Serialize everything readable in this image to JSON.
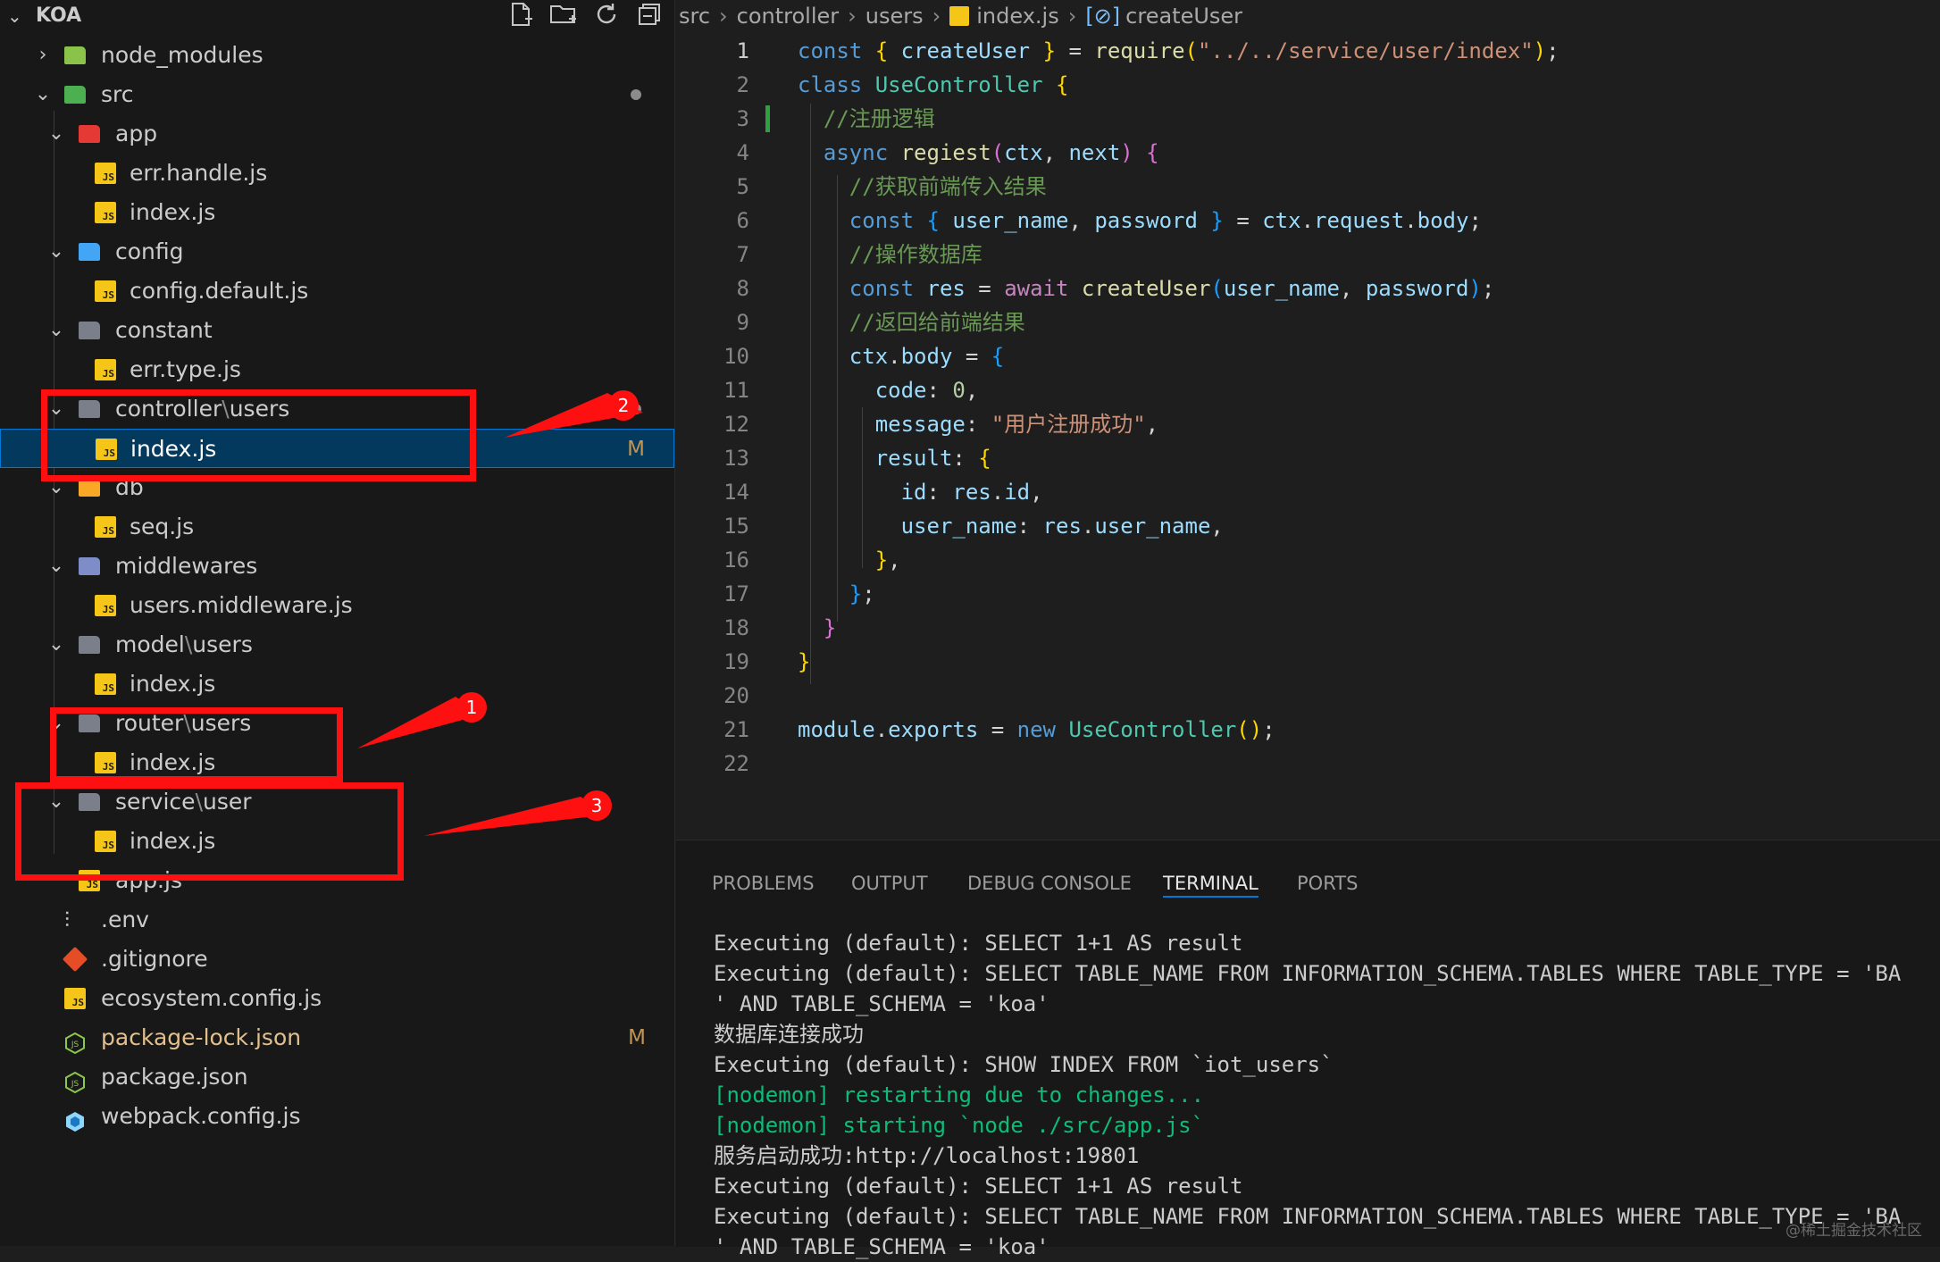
{
  "explorer": {
    "title": "KOA",
    "toolbar_icons": [
      "new-file-icon",
      "new-folder-icon",
      "refresh-icon",
      "collapse-all-icon"
    ],
    "tree": [
      {
        "label": "node_modules",
        "depth": 1,
        "kind": "folder",
        "expanded": false
      },
      {
        "label": "src",
        "depth": 1,
        "kind": "folder",
        "expanded": true
      },
      {
        "label": "app",
        "depth": 2,
        "kind": "folder",
        "expanded": true
      },
      {
        "label": "err.handle.js",
        "depth": 3,
        "kind": "js"
      },
      {
        "label": "index.js",
        "depth": 3,
        "kind": "js"
      },
      {
        "label": "config",
        "depth": 2,
        "kind": "folder",
        "expanded": true
      },
      {
        "label": "config.default.js",
        "depth": 3,
        "kind": "js"
      },
      {
        "label": "constant",
        "depth": 2,
        "kind": "folder",
        "expanded": true
      },
      {
        "label": "err.type.js",
        "depth": 3,
        "kind": "js"
      },
      {
        "label_a": "controller",
        "label_b": "users",
        "depth": 2,
        "kind": "folder",
        "expanded": true
      },
      {
        "label": "index.js",
        "depth": 3,
        "kind": "js",
        "selected": true,
        "badge": "M"
      },
      {
        "label": "db",
        "depth": 2,
        "kind": "folder",
        "expanded": true
      },
      {
        "label": "seq.js",
        "depth": 3,
        "kind": "js"
      },
      {
        "label": "middlewares",
        "depth": 2,
        "kind": "folder",
        "expanded": true
      },
      {
        "label": "users.middleware.js",
        "depth": 3,
        "kind": "js"
      },
      {
        "label_a": "model",
        "label_b": "users",
        "depth": 2,
        "kind": "folder",
        "expanded": true
      },
      {
        "label": "index.js",
        "depth": 3,
        "kind": "js"
      },
      {
        "label_a": "router",
        "label_b": "users",
        "depth": 2,
        "kind": "folder",
        "expanded": true
      },
      {
        "label": "index.js",
        "depth": 3,
        "kind": "js"
      },
      {
        "label_a": "service",
        "label_b": "user",
        "depth": 2,
        "kind": "folder",
        "expanded": true
      },
      {
        "label": "index.js",
        "depth": 3,
        "kind": "js"
      },
      {
        "label": "app.js",
        "depth": 2,
        "kind": "js"
      },
      {
        "label": ".env",
        "depth": 1,
        "kind": "env"
      },
      {
        "label": ".gitignore",
        "depth": 1,
        "kind": "git"
      },
      {
        "label": "ecosystem.config.js",
        "depth": 1,
        "kind": "js"
      },
      {
        "label": "package-lock.json",
        "depth": 1,
        "kind": "npm",
        "badge": "M"
      },
      {
        "label": "package.json",
        "depth": 1,
        "kind": "npm"
      },
      {
        "label": "webpack.config.js",
        "depth": 1,
        "kind": "webpack"
      }
    ],
    "annotations": [
      "1",
      "2",
      "3"
    ],
    "colors": {
      "highlight_red": "#ff1010",
      "selection": "#04395e",
      "modified": "#c09553"
    }
  },
  "breadcrumb": [
    "src",
    "controller",
    "users",
    "index.js",
    "createUser"
  ],
  "editor": {
    "active_line": 1,
    "line_numbers": [
      "1",
      "2",
      "3",
      "4",
      "5",
      "6",
      "7",
      "8",
      "9",
      "10",
      "11",
      "12",
      "13",
      "14",
      "15",
      "16",
      "17",
      "18",
      "19",
      "20",
      "21",
      "22"
    ],
    "lines": [
      [
        [
          "k",
          "const "
        ],
        [
          "p1",
          "{ "
        ],
        [
          "v",
          "createUser "
        ],
        [
          "p1",
          "} "
        ],
        [
          "op",
          "= "
        ],
        [
          "fn",
          "require"
        ],
        [
          "p1",
          "("
        ],
        [
          "s",
          "\"../../service/user/index\""
        ],
        [
          "p1",
          ")"
        ],
        [
          "op",
          ";"
        ]
      ],
      [
        [
          "k",
          "class "
        ],
        [
          "cls",
          "UseController "
        ],
        [
          "p1",
          "{"
        ]
      ],
      [
        [
          "c",
          "  //注册逻辑"
        ]
      ],
      [
        [
          "k",
          "  async "
        ],
        [
          "fn",
          "regiest"
        ],
        [
          "p2",
          "("
        ],
        [
          "v",
          "ctx"
        ],
        [
          "op",
          ", "
        ],
        [
          "v",
          "next"
        ],
        [
          "p2",
          ") {"
        ]
      ],
      [
        [
          "c",
          "    //获取前端传入结果"
        ]
      ],
      [
        [
          "k",
          "    const "
        ],
        [
          "p3",
          "{ "
        ],
        [
          "v",
          "user_name"
        ],
        [
          "op",
          ", "
        ],
        [
          "v",
          "password "
        ],
        [
          "p3",
          "} "
        ],
        [
          "op",
          "= "
        ],
        [
          "v",
          "ctx"
        ],
        [
          "op",
          "."
        ],
        [
          "v",
          "request"
        ],
        [
          "op",
          "."
        ],
        [
          "v",
          "body"
        ],
        [
          "op",
          ";"
        ]
      ],
      [
        [
          "c",
          "    //操作数据库"
        ]
      ],
      [
        [
          "k",
          "    const "
        ],
        [
          "v",
          "res "
        ],
        [
          "op",
          "= "
        ],
        [
          "ctl",
          "await "
        ],
        [
          "fn",
          "createUser"
        ],
        [
          "p3",
          "("
        ],
        [
          "v",
          "user_name"
        ],
        [
          "op",
          ", "
        ],
        [
          "v",
          "password"
        ],
        [
          "p3",
          ")"
        ],
        [
          "op",
          ";"
        ]
      ],
      [
        [
          "c",
          "    //返回给前端结果"
        ]
      ],
      [
        [
          "v",
          "    ctx"
        ],
        [
          "op",
          "."
        ],
        [
          "v",
          "body "
        ],
        [
          "op",
          "= "
        ],
        [
          "p3",
          "{"
        ]
      ],
      [
        [
          "v",
          "      code"
        ],
        [
          "op",
          ": "
        ],
        [
          "n",
          "0"
        ],
        [
          "op",
          ","
        ]
      ],
      [
        [
          "v",
          "      message"
        ],
        [
          "op",
          ": "
        ],
        [
          "s",
          "\"用户注册成功\""
        ],
        [
          "op",
          ","
        ]
      ],
      [
        [
          "v",
          "      result"
        ],
        [
          "op",
          ": "
        ],
        [
          "p1",
          "{"
        ]
      ],
      [
        [
          "v",
          "        id"
        ],
        [
          "op",
          ": "
        ],
        [
          "v",
          "res"
        ],
        [
          "op",
          "."
        ],
        [
          "v",
          "id"
        ],
        [
          "op",
          ","
        ]
      ],
      [
        [
          "v",
          "        user_name"
        ],
        [
          "op",
          ": "
        ],
        [
          "v",
          "res"
        ],
        [
          "op",
          "."
        ],
        [
          "v",
          "user_name"
        ],
        [
          "op",
          ","
        ]
      ],
      [
        [
          "p1",
          "      }"
        ],
        [
          "op",
          ","
        ]
      ],
      [
        [
          "p3",
          "    }"
        ],
        [
          "op",
          ";"
        ]
      ],
      [
        [
          "p2",
          "  }"
        ]
      ],
      [
        [
          "p1",
          "}"
        ]
      ],
      [],
      [
        [
          "v",
          "module"
        ],
        [
          "op",
          "."
        ],
        [
          "v",
          "exports "
        ],
        [
          "op",
          "= "
        ],
        [
          "k",
          "new "
        ],
        [
          "cls",
          "UseController"
        ],
        [
          "p1",
          "()"
        ],
        [
          "op",
          ";"
        ]
      ],
      []
    ]
  },
  "panel": {
    "tabs": [
      "PROBLEMS",
      "OUTPUT",
      "DEBUG CONSOLE",
      "TERMINAL",
      "PORTS"
    ],
    "active_tab": "TERMINAL",
    "terminal_lines": [
      {
        "text": "Executing (default): SELECT 1+1 AS result",
        "color": "default"
      },
      {
        "text": "Executing (default): SELECT TABLE_NAME FROM INFORMATION_SCHEMA.TABLES WHERE TABLE_TYPE = 'BA",
        "color": "default"
      },
      {
        "text": "' AND TABLE_SCHEMA = 'koa'",
        "color": "default"
      },
      {
        "text": "数据库连接成功",
        "color": "default"
      },
      {
        "text": "Executing (default): SHOW INDEX FROM `iot_users`",
        "color": "default"
      },
      {
        "text": "[nodemon] restarting due to changes...",
        "color": "green"
      },
      {
        "text": "[nodemon] starting `node ./src/app.js`",
        "color": "green"
      },
      {
        "text": "服务启动成功:http://localhost:19801",
        "color": "default"
      },
      {
        "text": "Executing (default): SELECT 1+1 AS result",
        "color": "default"
      },
      {
        "text": "Executing (default): SELECT TABLE_NAME FROM INFORMATION_SCHEMA.TABLES WHERE TABLE_TYPE = 'BA",
        "color": "default"
      },
      {
        "text": "' AND TABLE_SCHEMA = 'koa'",
        "color": "default"
      }
    ]
  },
  "watermark": "@稀土掘金技术社区"
}
